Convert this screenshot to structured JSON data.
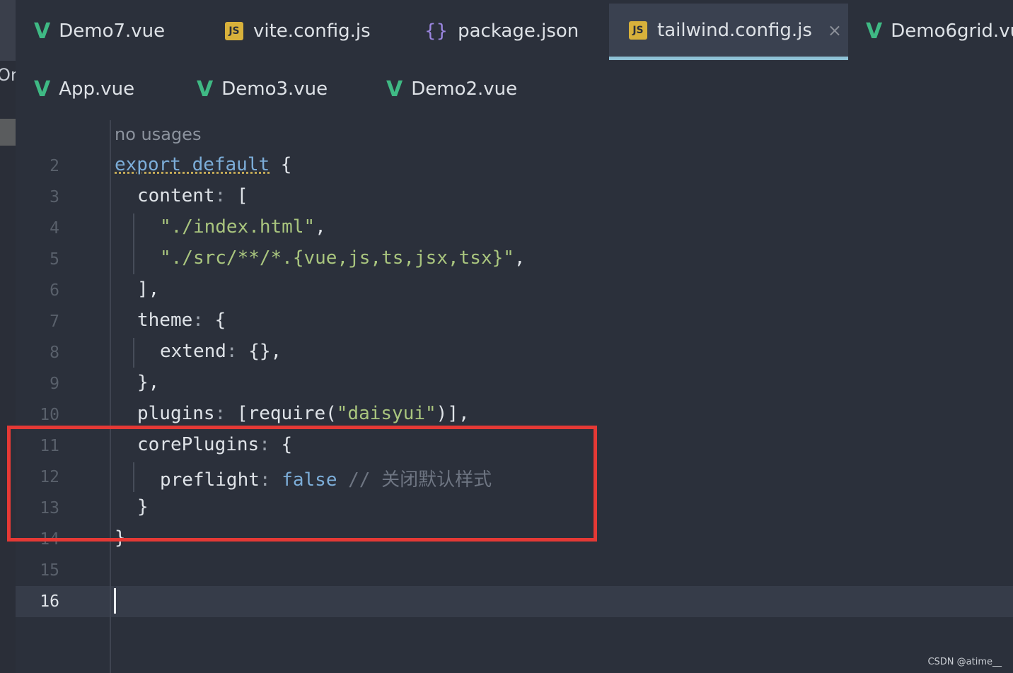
{
  "tabs_row1": [
    {
      "label": "Demo7.vue",
      "icon": "vue-icon",
      "active": false
    },
    {
      "label": "vite.config.js",
      "icon": "js-icon",
      "active": false
    },
    {
      "label": "package.json",
      "icon": "json-icon",
      "active": false
    },
    {
      "label": "tailwind.config.js",
      "icon": "js-icon",
      "active": true,
      "close": "×"
    },
    {
      "label": "Demo6grid.vu",
      "icon": "vue-icon",
      "active": false
    }
  ],
  "tabs_row2": [
    {
      "label": "App.vue",
      "icon": "vue-icon"
    },
    {
      "label": "Demo3.vue",
      "icon": "vue-icon"
    },
    {
      "label": "Demo2.vue",
      "icon": "vue-icon"
    }
  ],
  "icons": {
    "vue": "V",
    "js": "JS",
    "json": "{}"
  },
  "left_fragment": "Or",
  "editor": {
    "usage_hint": "no usages",
    "line_numbers": [
      "2",
      "3",
      "4",
      "5",
      "6",
      "7",
      "8",
      "9",
      "10",
      "11",
      "12",
      "13",
      "14",
      "15",
      "16"
    ],
    "current_line": "16",
    "lines": {
      "l2_kw": "export default",
      "l2_rest": " {",
      "l3_key": "content",
      "l3_colon": ":",
      "l3_rest": " [",
      "l4_str": "\"./index.html\"",
      "l4_comma": ",",
      "l5_str": "\"./src/**/*.{vue,js,ts,jsx,tsx}\"",
      "l5_comma": ",",
      "l6": "],",
      "l7_key": "theme",
      "l7_colon": ":",
      "l7_rest": " {",
      "l8_key": "extend",
      "l8_colon": ":",
      "l8_rest": " {},",
      "l9": "},",
      "l10_key": "plugins",
      "l10_colon": ":",
      "l10_open": " [require(",
      "l10_str": "\"daisyui\"",
      "l10_close": ")],",
      "l11_key": "corePlugins",
      "l11_colon": ":",
      "l11_rest": " {",
      "l12_key": "preflight",
      "l12_colon": ":",
      "l12_bool": " false",
      "l12_comment": " // 关闭默认样式",
      "l13": "}",
      "l14": "}"
    }
  },
  "colors": {
    "highlight_box": "#e53935",
    "vue_green": "#3fb984",
    "js_yellow": "#d8b13b",
    "active_tab_underline": "#8ec1d6"
  },
  "watermark": "CSDN @atime__"
}
